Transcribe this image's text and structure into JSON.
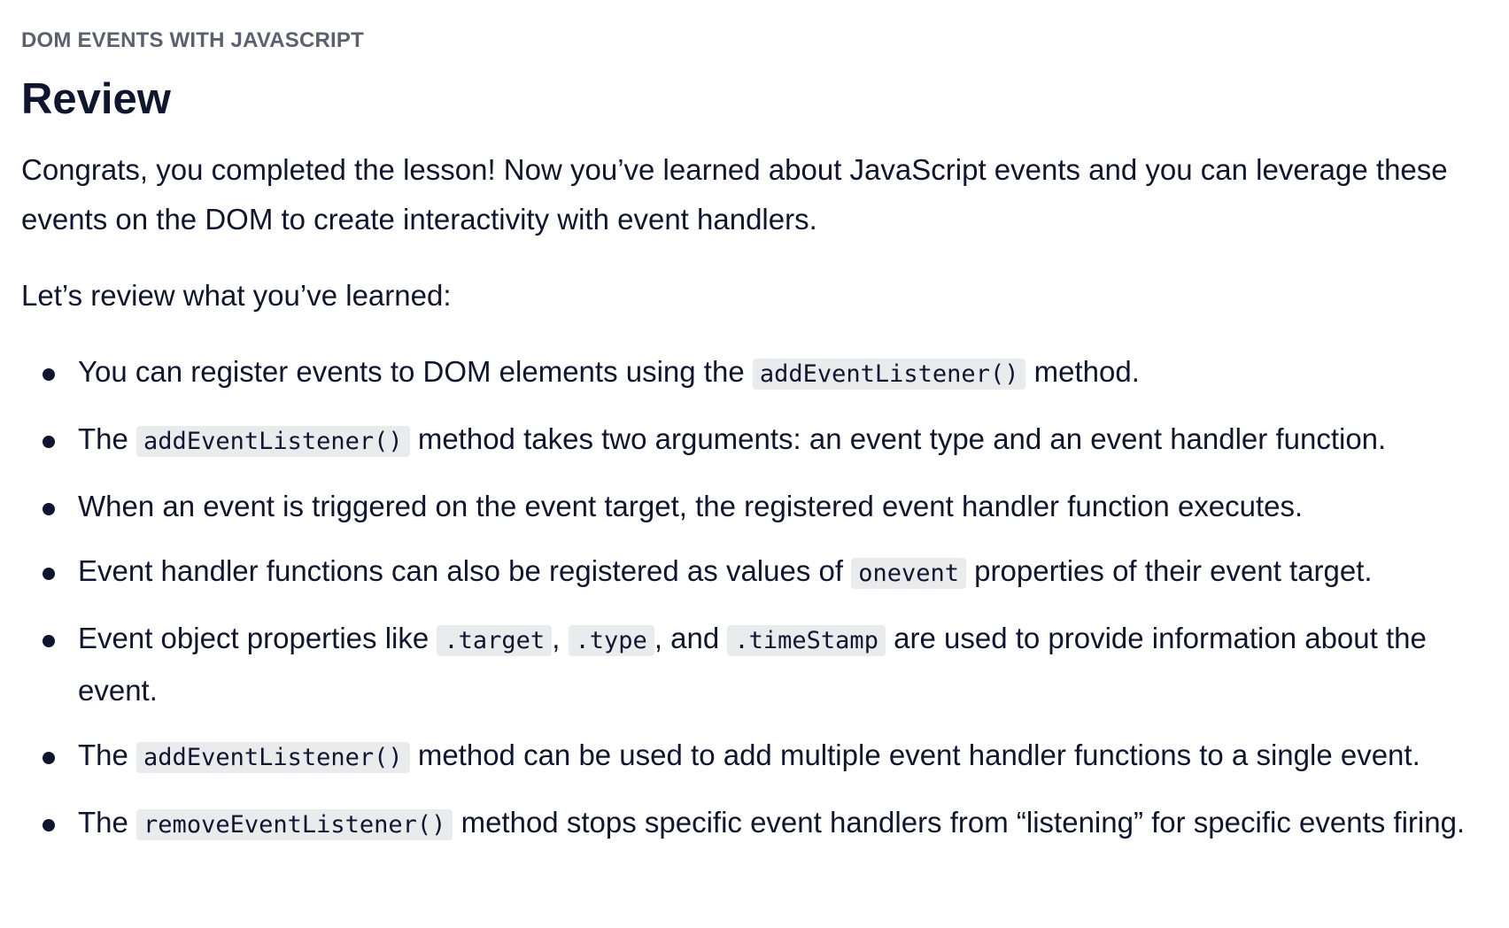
{
  "lesson": {
    "eyebrow": "DOM EVENTS WITH JAVASCRIPT",
    "title": "Review",
    "intro": "Congrats, you completed the lesson! Now you’ve learned about JavaScript events and you can leverage these events on the DOM to create interactivity with event handlers.",
    "review_intro": "Let’s review what you’ve learned:"
  },
  "points": [
    {
      "t1": "You can register events to DOM elements using the ",
      "c1": "addEventListener()",
      "t2": " method."
    },
    {
      "t1": "The ",
      "c1": "addEventListener()",
      "t2": " method takes two arguments: an event type and an event handler function."
    },
    {
      "t1": "When an event is triggered on the event target, the registered event handler function executes."
    },
    {
      "t1": "Event handler functions can also be registered as values of ",
      "c1": "onevent",
      "t2": " properties of their event target."
    },
    {
      "t1": "Event object properties like ",
      "c1": ".target",
      "t2": ", ",
      "c2": ".type",
      "t3": ", and ",
      "c3": ".timeStamp",
      "t4": " are used to provide information about the event."
    },
    {
      "t1": "The ",
      "c1": "addEventListener()",
      "t2": " method can be used to add multiple event handler functions to a single event."
    },
    {
      "t1": "The ",
      "c1": "removeEventListener()",
      "t2": " method stops specific event handlers from “listening” for specific events firing."
    }
  ]
}
